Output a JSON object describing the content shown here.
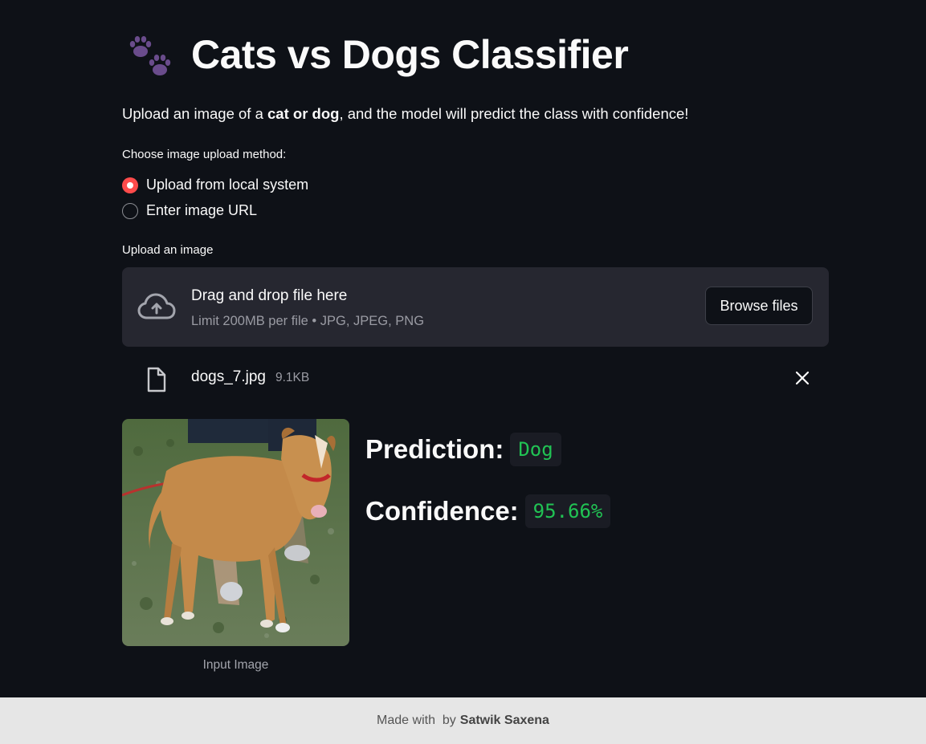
{
  "header": {
    "title": "Cats vs Dogs Classifier",
    "icon": "paw-prints-icon"
  },
  "intro": {
    "before": "Upload an image of a ",
    "bold": "cat or dog",
    "after": ", and the model will predict the class with confidence!"
  },
  "upload_method": {
    "label": "Choose image upload method:",
    "options": [
      {
        "label": "Upload from local system",
        "selected": true
      },
      {
        "label": "Enter image URL",
        "selected": false
      }
    ]
  },
  "uploader": {
    "label": "Upload an image",
    "drag_text": "Drag and drop file here",
    "limit_text": "Limit 200MB per file • JPG, JPEG, PNG",
    "browse_label": "Browse files"
  },
  "file": {
    "name": "dogs_7.jpg",
    "size": "9.1KB"
  },
  "result": {
    "image_caption": "Input Image",
    "prediction_label": "Prediction:",
    "prediction_value": "Dog",
    "confidence_label": "Confidence:",
    "confidence_value": "95.66%"
  },
  "footer": {
    "text": "Made with  by",
    "author": "Satwik Saxena"
  },
  "colors": {
    "background": "#0e1117",
    "accent": "#ff4b4b",
    "result_green": "#21c354",
    "panel": "#262730",
    "footer_bg": "#e6e6e6"
  }
}
